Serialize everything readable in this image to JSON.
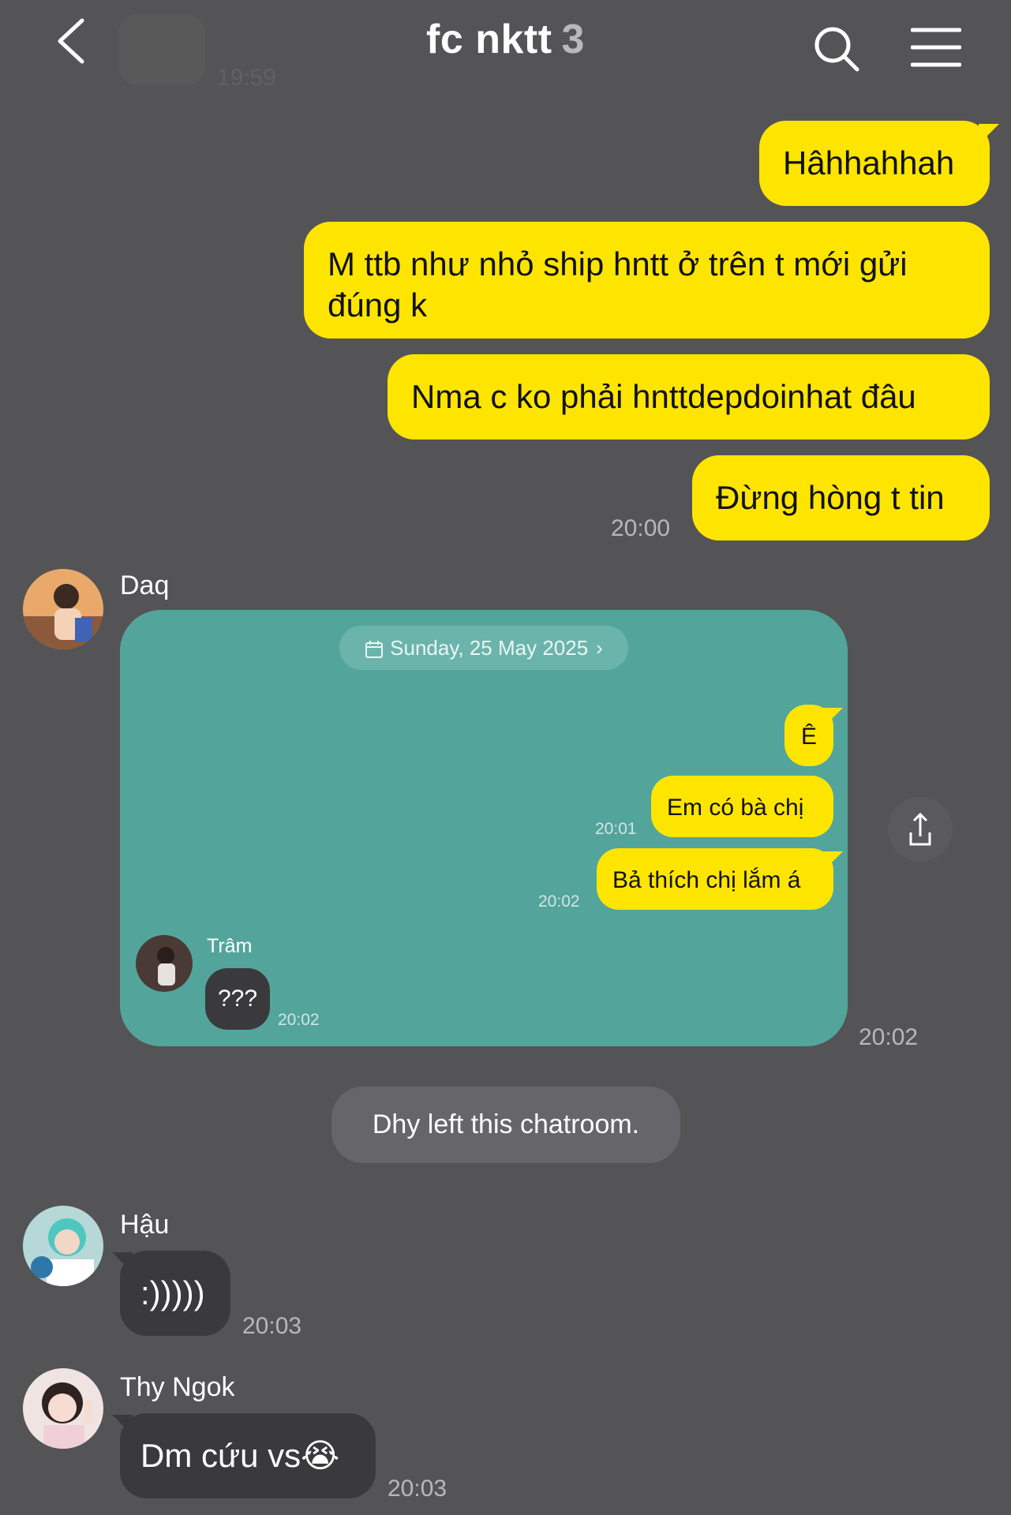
{
  "header": {
    "title": "fc nktt",
    "member_count": "3"
  },
  "ghost_time": "19:59",
  "outgoing": [
    {
      "text": "Hâhhahhah"
    },
    {
      "text": "M ttb như nhỏ ship hntt ở trên t mới gửi đúng k"
    },
    {
      "text": "Nma c ko phải hnttdepdoinhat đâu"
    },
    {
      "text": "Đừng hòng t tin"
    }
  ],
  "outgoing_time": "20:00",
  "shared": {
    "sender": "Daq",
    "date_label": "Sunday, 25 May 2025",
    "time": "20:02",
    "messages": [
      {
        "text": "Ê",
        "time": ""
      },
      {
        "text": "Em có bà chị",
        "time": "20:01"
      },
      {
        "text": "Bả thích chị lắm á",
        "time": "20:02"
      }
    ],
    "reply": {
      "sender": "Trâm",
      "text": "???",
      "time": "20:02"
    }
  },
  "system_message": "Dhy left this chatroom.",
  "incoming": [
    {
      "sender": "Hậu",
      "text": ":)))))",
      "time": "20:03"
    },
    {
      "sender": "Thy Ngok",
      "text": "Dm cứu vs😭",
      "time": "20:03"
    }
  ],
  "colors": {
    "background": "#545456",
    "my_bubble": "#fee500",
    "their_bubble": "#3a3a3c",
    "card": "#53a59c"
  }
}
